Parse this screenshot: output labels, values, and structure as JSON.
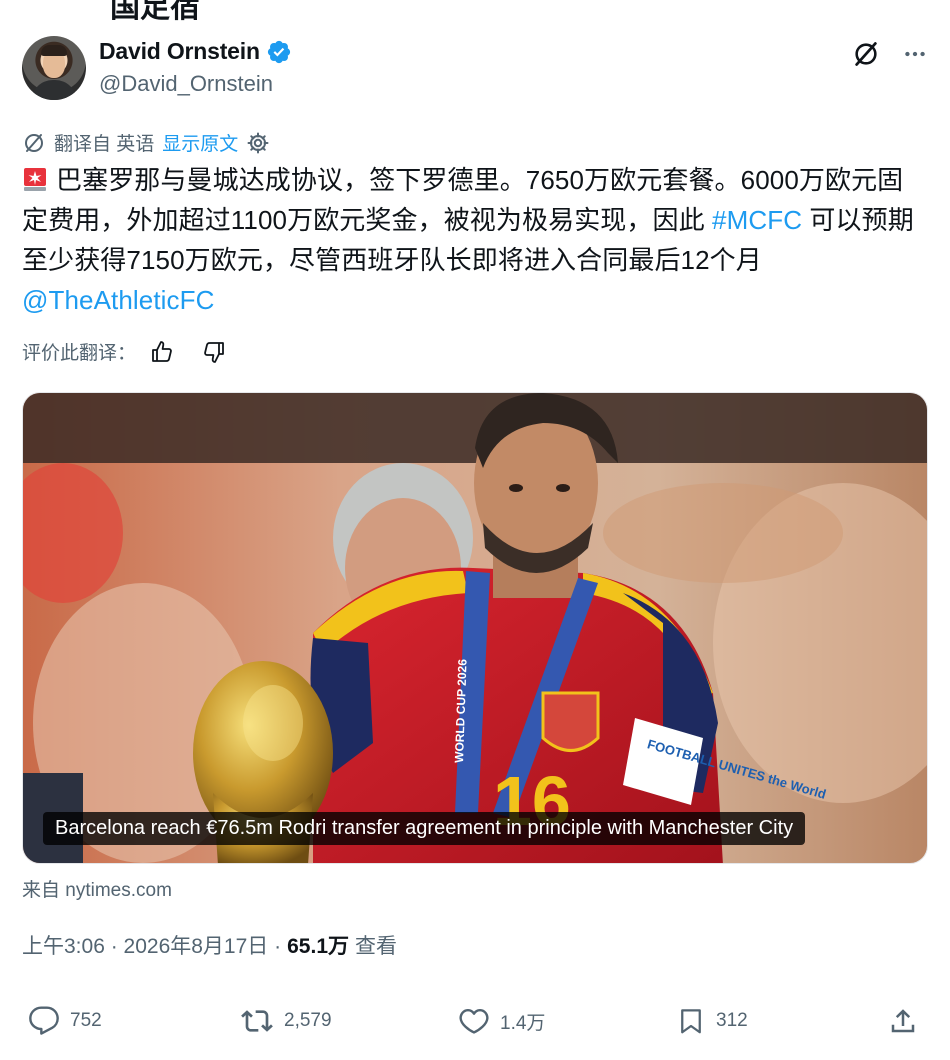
{
  "top_cut_text": "国足宿",
  "author": {
    "name": "David Ornstein",
    "handle": "@David_Ornstein",
    "verified_color": "#1d9bf0"
  },
  "header_icons": [
    "grok-icon",
    "more-icon"
  ],
  "translation": {
    "from_label": "翻译自 英语",
    "show_original": "显示原文"
  },
  "post": {
    "line1": "巴塞罗那与曼城达成协议，签下罗德里。7650万欧元套餐。6000万欧元固定费用，外加超过1100万欧元奖金，被视为极易实现，因此 ",
    "hashtag": "#MCFC",
    "line2": " 可以预期至少获得7150万欧元，尽管西班牙队长即将进入合同最后12个月",
    "mention": "@TheAthleticFC"
  },
  "rate": {
    "label": "评价此翻译："
  },
  "media": {
    "caption": "Barcelona reach €76.5m Rodri transfer agreement in principle with Manchester City",
    "jersey_number": "16",
    "lanyard_text": "WORLD CUP 2026",
    "armband_text": "FOOTBALL UNITES the World"
  },
  "source": "来自 nytimes.com",
  "meta": {
    "time": "上午3:06 · 2026年8月17日 · ",
    "views": "65.1万",
    "views_label": " 查看"
  },
  "actions": {
    "replies": "752",
    "reposts": "2,579",
    "likes": "1.4万",
    "bookmarks": "312"
  },
  "colors": {
    "link": "#1d9bf0",
    "secondary_text": "#536471",
    "primary_text": "#0f1419"
  }
}
